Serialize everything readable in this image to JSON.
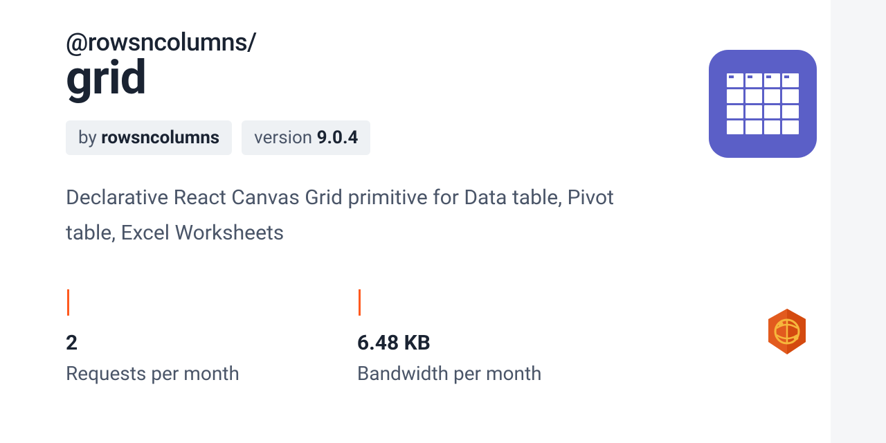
{
  "package": {
    "scope": "@rowsncolumns/",
    "name": "grid",
    "author_prefix": "by ",
    "author": "rowsncolumns",
    "version_prefix": "version ",
    "version": "9.0.4",
    "description": "Declarative React Canvas Grid primitive for Data table, Pivot table, Excel Worksheets"
  },
  "stats": {
    "requests": {
      "value": "2",
      "label": "Requests per month"
    },
    "bandwidth": {
      "value": "6.48 KB",
      "label": "Bandwidth per month"
    }
  }
}
